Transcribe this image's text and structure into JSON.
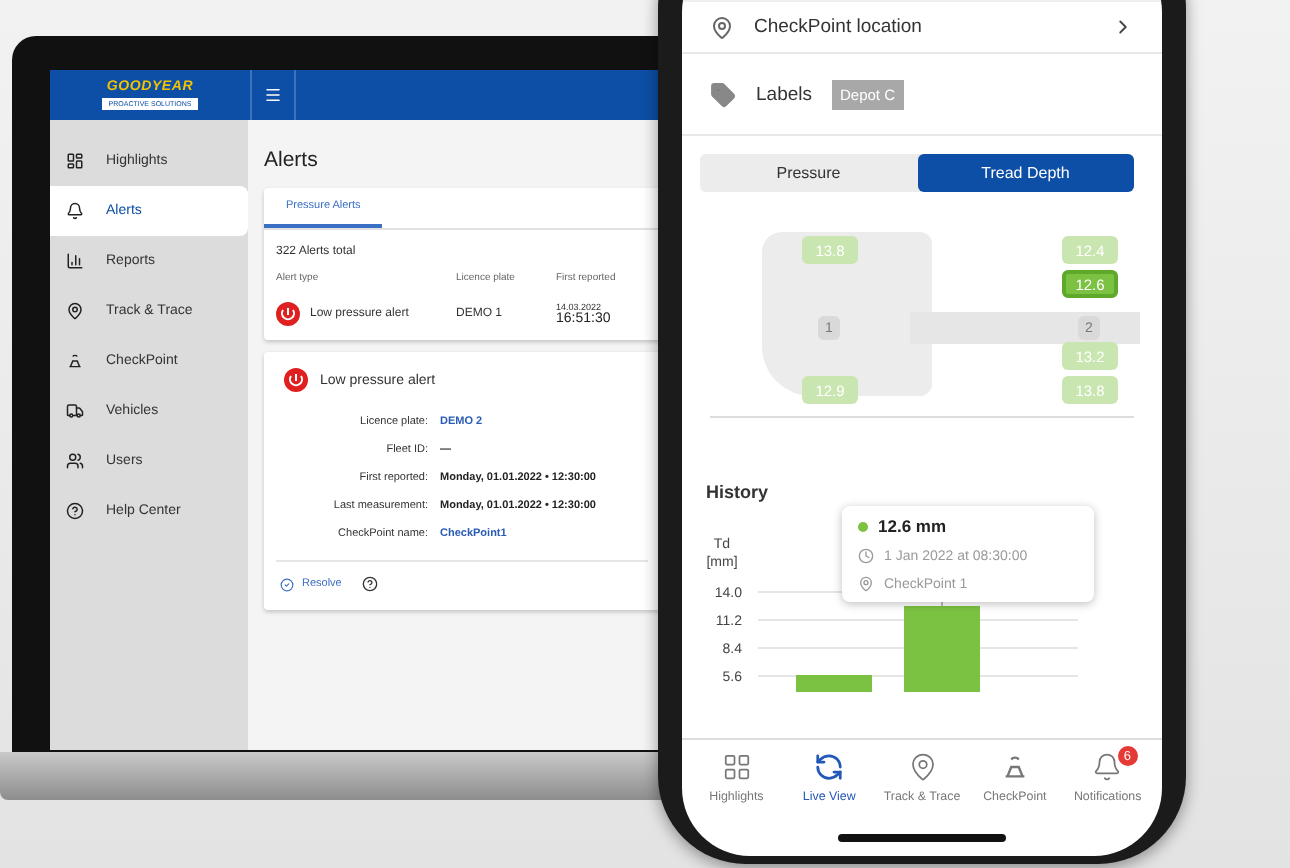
{
  "laptop": {
    "logo": {
      "brand": "GOODYEAR",
      "tagline": "PROACTIVE SOLUTIONS"
    },
    "sidebar": {
      "items": [
        {
          "label": "Highlights",
          "selected": false
        },
        {
          "label": "Alerts",
          "selected": true
        },
        {
          "label": "Reports",
          "selected": false
        },
        {
          "label": "Track & Trace",
          "selected": false
        },
        {
          "label": "CheckPoint",
          "selected": false
        },
        {
          "label": "Vehicles",
          "selected": false
        },
        {
          "label": "Users",
          "selected": false
        },
        {
          "label": "Help Center",
          "selected": false
        }
      ]
    },
    "page_title": "Alerts",
    "tabs": [
      {
        "label": "Pressure Alerts",
        "selected": true
      }
    ],
    "total": "322 Alerts total",
    "table": {
      "columns": [
        "Alert type",
        "Licence plate",
        "First reported"
      ],
      "rows": [
        {
          "alert_type": "Low pressure alert",
          "licence_plate": "DEMO 1",
          "date": "14.03.2022",
          "time": "16:51:30"
        }
      ]
    },
    "detail": {
      "title": "Low pressure alert",
      "fields": [
        {
          "label": "Licence plate:",
          "value": "DEMO 2",
          "kind": "link"
        },
        {
          "label": "Fleet ID:",
          "value": "—",
          "kind": "bold"
        },
        {
          "label": "First reported:",
          "value": "Monday, 01.01.2022 • 12:30:00",
          "kind": "bold"
        },
        {
          "label": "Last measurement:",
          "value": "Monday, 01.01.2022 • 12:30:00",
          "kind": "bold"
        },
        {
          "label": "CheckPoint name:",
          "value": "CheckPoint1",
          "kind": "link"
        }
      ],
      "resolve": "Resolve"
    }
  },
  "phone": {
    "location_row": {
      "label": "CheckPoint location"
    },
    "labels_row": {
      "label": "Labels",
      "tags": [
        "Depot C"
      ]
    },
    "toggle": [
      {
        "label": "Pressure",
        "selected": false
      },
      {
        "label": "Tread Depth",
        "selected": true
      }
    ],
    "axles": [
      {
        "number": "1",
        "tyres": [
          {
            "value": "13.8",
            "selected": false
          },
          {
            "value": "12.9",
            "selected": false
          }
        ]
      },
      {
        "number": "2",
        "tyres": [
          {
            "value": "12.4",
            "selected": false
          },
          {
            "value": "12.6",
            "selected": true
          },
          {
            "value": "13.2",
            "selected": false
          },
          {
            "value": "13.8",
            "selected": false
          }
        ]
      }
    ],
    "history": {
      "title": "History",
      "tooltip": {
        "value": "12.6 mm",
        "date": "1 Jan 2022 at 08:30:00",
        "location": "CheckPoint 1"
      },
      "chart_data": {
        "type": "bar",
        "ylabel": "Td [mm]",
        "values": [
          5.7,
          12.6
        ],
        "yticks": [
          {
            "value": 5.6,
            "label": "5.6"
          },
          {
            "value": 8.4,
            "label": "8.4"
          },
          {
            "value": 11.2,
            "label": "11.2"
          },
          {
            "value": 14,
            "label": "14.0"
          }
        ],
        "ylim": [
          4,
          14
        ],
        "grid": true
      }
    },
    "nav": [
      {
        "label": "Highlights",
        "selected": false
      },
      {
        "label": "Live View",
        "selected": true
      },
      {
        "label": "Track & Trace",
        "selected": false
      },
      {
        "label": "CheckPoint",
        "selected": false
      },
      {
        "label": "Notifications",
        "selected": false,
        "badge": "6"
      }
    ]
  }
}
